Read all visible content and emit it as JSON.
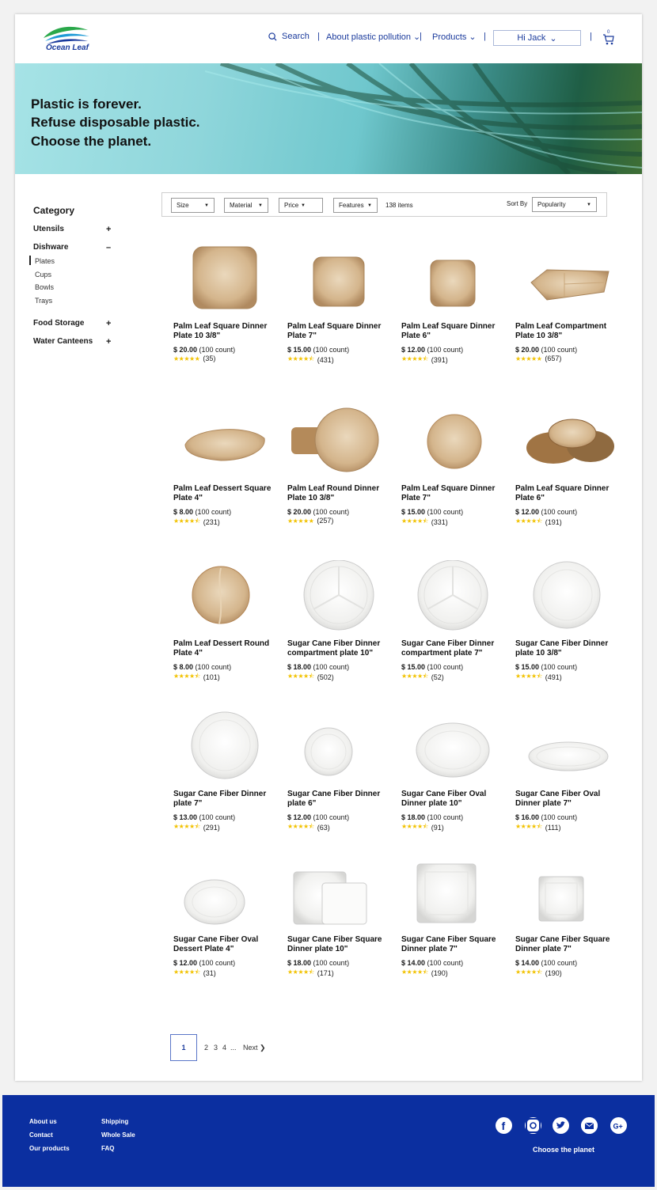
{
  "header": {
    "logo_text": "Ocean Leaf",
    "search_label": "Search",
    "about_label": "About plastic pollution",
    "products_label": "Products",
    "user_label": "Hi Jack",
    "cart_count": "0"
  },
  "hero": {
    "line1": "Plastic is forever.",
    "line2": "Refuse disposable plastic.",
    "line3": "Choose the planet."
  },
  "sidebar": {
    "title": "Category",
    "categories": [
      {
        "label": "Utensils",
        "sign": "+"
      },
      {
        "label": "Dishware",
        "sign": "–"
      },
      {
        "label": "Food Storage",
        "sign": "+"
      },
      {
        "label": "Water Canteens",
        "sign": "+"
      }
    ],
    "dishware_items": [
      "Plates",
      "Cups",
      "Bowls",
      "Trays"
    ]
  },
  "filters": {
    "size": "Size",
    "material": "Material",
    "price": "Price",
    "features": "Features",
    "count": "138 items",
    "sort_label": "Sort By",
    "sort_value": "Popularity"
  },
  "products": [
    {
      "name": "Palm Leaf Square Dinner Plate  10 3/8\"",
      "price": "$ 20.00",
      "count": "(100 count)",
      "stars": "★★★★★",
      "reviews": "(35)"
    },
    {
      "name": "Palm Leaf Square Dinner Plate  7\"",
      "price": "$ 15.00",
      "count": "(100 count)",
      "stars": "★★★★⯪",
      "reviews": "(431)"
    },
    {
      "name": "Palm Leaf Square Dinner Plate  6\"",
      "price": "$ 12.00",
      "count": "(100 count)",
      "stars": "★★★★⯪",
      "reviews": "(391)"
    },
    {
      "name": "Palm Leaf Compartment Plate  10 3/8\"",
      "price": "$ 20.00",
      "count": "(100 count)",
      "stars": "★★★★★",
      "reviews": "(657)"
    },
    {
      "name": "Palm Leaf Dessert Square Plate  4\"",
      "price": "$ 8.00",
      "count": "(100 count)",
      "stars": "★★★★⯪",
      "reviews": "(231)"
    },
    {
      "name": "Palm Leaf Round Dinner Plate  10 3/8\"",
      "price": "$ 20.00",
      "count": "(100 count)",
      "stars": "★★★★★",
      "reviews": "(257)"
    },
    {
      "name": "Palm Leaf Square Dinner Plate  7\"",
      "price": "$ 15.00",
      "count": "(100 count)",
      "stars": "★★★★⯪",
      "reviews": "(331)"
    },
    {
      "name": "Palm Leaf Square Dinner Plate  6\"",
      "price": "$ 12.00",
      "count": "(100 count)",
      "stars": "★★★★⯪",
      "reviews": "(191)"
    },
    {
      "name": "Palm Leaf Dessert Round Plate  4\"",
      "price": "$ 8.00",
      "count": "(100 count)",
      "stars": "★★★★⯪",
      "reviews": "(101)"
    },
    {
      "name": "Sugar Cane Fiber Dinner compartment plate 10\"",
      "price": "$ 18.00",
      "count": "(100 count)",
      "stars": "★★★★⯪",
      "reviews": "(502)"
    },
    {
      "name": "Sugar Cane Fiber Dinner compartment plate 7\"",
      "price": "$ 15.00",
      "count": "(100 count)",
      "stars": "★★★★⯪",
      "reviews": "(52)"
    },
    {
      "name": "Sugar Cane Fiber Dinner plate 10 3/8\"",
      "price": "$ 15.00",
      "count": "(100 count)",
      "stars": "★★★★⯪",
      "reviews": "(491)"
    },
    {
      "name": "Sugar Cane Fiber Dinner plate 7\"",
      "price": "$ 13.00",
      "count": "(100 count)",
      "stars": "★★★★⯪",
      "reviews": "(291)"
    },
    {
      "name": "Sugar Cane Fiber Dinner plate 6\"",
      "price": "$ 12.00",
      "count": "(100 count)",
      "stars": "★★★★⯪",
      "reviews": "(63)"
    },
    {
      "name": "Sugar Cane Fiber Oval Dinner plate 10\"",
      "price": "$ 18.00",
      "count": "(100 count)",
      "stars": "★★★★⯪",
      "reviews": "(91)"
    },
    {
      "name": "Sugar Cane Fiber Oval Dinner plate 7\"",
      "price": "$ 16.00",
      "count": "(100 count)",
      "stars": "★★★★⯪",
      "reviews": "(111)"
    },
    {
      "name": "Sugar Cane Fiber Oval Dessert Plate  4\"",
      "price": "$ 12.00",
      "count": "(100 count)",
      "stars": "★★★★⯪",
      "reviews": "(31)"
    },
    {
      "name": "Sugar Cane Fiber Square Dinner plate 10\"",
      "price": "$ 18.00",
      "count": "(100 count)",
      "stars": "★★★★⯪",
      "reviews": "(171)"
    },
    {
      "name": "Sugar Cane Fiber Square Dinner plate 7\"",
      "price": "$ 14.00",
      "count": "(100 count)",
      "stars": "★★★★⯪",
      "reviews": "(190)"
    },
    {
      "name": "Sugar Cane Fiber Square Dinner plate 7\"",
      "price": "$ 14.00",
      "count": "(100 count)",
      "stars": "★★★★⯪",
      "reviews": "(190)"
    }
  ],
  "pagination": {
    "current": "1",
    "pages": [
      "2",
      "3",
      "4",
      "..."
    ],
    "next_label": "Next ❯"
  },
  "footer": {
    "col1": [
      "About us",
      "Contact",
      "Our products"
    ],
    "col2": [
      "Shipping",
      "Whole Sale",
      "FAQ"
    ],
    "social": [
      "facebook-icon",
      "instagram-icon",
      "twitter-icon",
      "mail-icon",
      "google-plus-icon"
    ],
    "tagline": "Choose the planet"
  },
  "colors": {
    "brand": "#1a3a9c",
    "footer": "#0b2fa0",
    "star": "#f2c200"
  }
}
